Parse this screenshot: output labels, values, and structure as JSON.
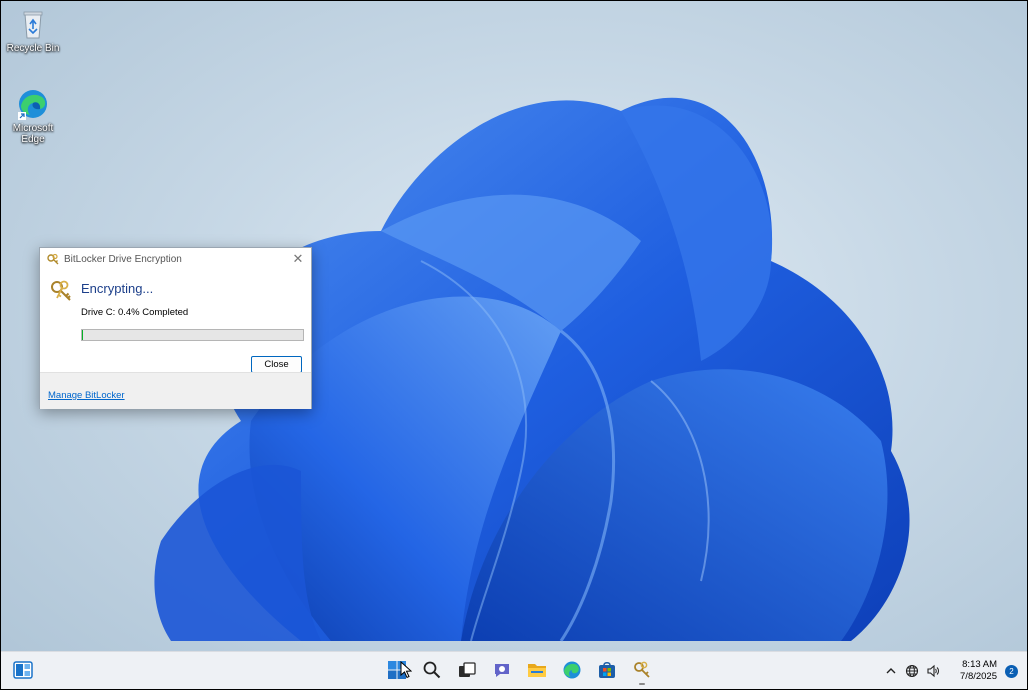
{
  "desktop": {
    "icons": [
      {
        "label": "Recycle Bin",
        "icon": "recycle-bin-icon"
      },
      {
        "label": "Microsoft Edge",
        "icon": "edge-icon"
      }
    ]
  },
  "dialog": {
    "title": "BitLocker Drive Encryption",
    "heading": "Encrypting...",
    "status": "Drive C: 0.4% Completed",
    "progress_percent": 0.4,
    "close_label": "Close",
    "manage_link": "Manage BitLocker",
    "title_icon": "bitlocker-keys-icon",
    "close_x_glyph": "✕"
  },
  "taskbar": {
    "apps": [
      {
        "name": "start",
        "icon": "windows-start-icon"
      },
      {
        "name": "search",
        "icon": "search-icon"
      },
      {
        "name": "task-view",
        "icon": "task-view-icon"
      },
      {
        "name": "chat",
        "icon": "teams-chat-icon"
      },
      {
        "name": "file-explorer",
        "icon": "folder-icon"
      },
      {
        "name": "edge",
        "icon": "edge-icon"
      },
      {
        "name": "store",
        "icon": "store-icon"
      },
      {
        "name": "bitlocker",
        "icon": "bitlocker-keys-icon"
      }
    ],
    "tray": {
      "chevron_glyph": "^",
      "time": "8:13 AM",
      "date": "7/8/2025",
      "notifications": "2"
    }
  },
  "colors": {
    "accent": "#0067c0",
    "progress_fill": "#06b025",
    "heading": "#1c3f8a",
    "link": "#0066cc",
    "bloom_blue": "#1f5fe0"
  }
}
